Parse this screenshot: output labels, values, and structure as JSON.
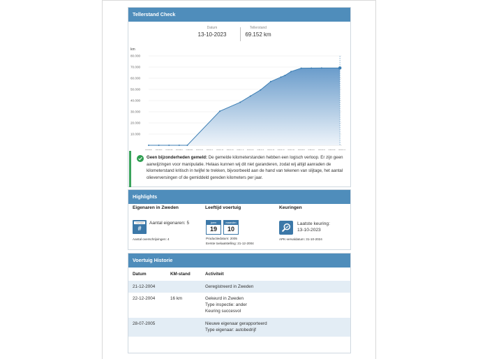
{
  "teller": {
    "title": "Tellerstand Check",
    "datum_label": "Datum",
    "datum_value": "13-10-2023",
    "stand_label": "Tellerstand",
    "stand_value": "69.152 km",
    "notice_bold": "Geen bijzonderheden gemeld:",
    "notice_text": " De gemelde kilometerstanden hebben een logisch verloop. Er zijn geen aanwijzingen voor manipulatie. Helaas kunnen wij dit niet garanderen, zodat wij altijd aanraden de kilometerstand kritisch in twijfel te trekken, bijvoorbeeld aan de hand van tekenen van slijtage, het aantal olieverversingen of de gemiddeld gereden kilometers per jaar."
  },
  "chart_data": {
    "type": "area",
    "ylabel": "km",
    "ylim": [
      0,
      80000
    ],
    "yticks": [
      10000,
      20000,
      30000,
      40000,
      50000,
      60000,
      70000,
      80000
    ],
    "ytick_labels": [
      "10.000",
      "20.000",
      "30.000",
      "40.000",
      "50.000",
      "60.000",
      "70.000",
      "80.000"
    ],
    "xlim": [
      2005,
      2024
    ],
    "xticks": [
      2005,
      2006,
      2007,
      2008,
      2009,
      2010,
      2011,
      2012,
      2013,
      2014,
      2015,
      2016,
      2017,
      2018,
      2019,
      2020,
      2021,
      2022,
      2023,
      2024
    ],
    "points": [
      {
        "x": 2005.0,
        "y": 16
      },
      {
        "x": 2006.0,
        "y": 16
      },
      {
        "x": 2007.0,
        "y": 16
      },
      {
        "x": 2008.0,
        "y": 16
      },
      {
        "x": 2008.8,
        "y": 16
      },
      {
        "x": 2012.0,
        "y": 30500
      },
      {
        "x": 2014.0,
        "y": 38500
      },
      {
        "x": 2015.0,
        "y": 44000
      },
      {
        "x": 2016.0,
        "y": 49500
      },
      {
        "x": 2017.0,
        "y": 57000
      },
      {
        "x": 2018.0,
        "y": 61000
      },
      {
        "x": 2018.4,
        "y": 62500
      },
      {
        "x": 2019.0,
        "y": 66000
      },
      {
        "x": 2020.0,
        "y": 69000
      },
      {
        "x": 2021.0,
        "y": 69100
      },
      {
        "x": 2022.0,
        "y": 69120
      },
      {
        "x": 2023.8,
        "y": 69152
      }
    ],
    "colors": {
      "line": "#3d7fb4",
      "fill_top": "#6a9ccb",
      "fill_bottom": "#eef4fa",
      "grid": "#e8e8e8"
    }
  },
  "highlights": {
    "title": "Highlights",
    "owners": {
      "title": "Eigenaren in Zweden",
      "card_label": "OWNER",
      "card_symbol": "#",
      "count_text": "Aantal eigenaren: 5",
      "transfers": "Aantal overschrijvingen: 4"
    },
    "age": {
      "title": "Leeftijd voertuig",
      "years_label": "jaren",
      "years": "19",
      "months_label": "maanden",
      "months": "10",
      "production": "Productiedatum: 2005",
      "first_admission": "Eerste toelaatstelling: 21-12-2004"
    },
    "inspection": {
      "title": "Keuringen",
      "last_label": "Laatste keuring:",
      "last_date": "13-10-2023",
      "apk": "APK-vervaldatum: 31-10-2024"
    }
  },
  "history": {
    "title": "Voertuig Historie",
    "columns": [
      "Datum",
      "KM-stand",
      "Activiteit"
    ],
    "rows": [
      {
        "date": "21-12-2004",
        "km": "",
        "lines": [
          "Geregistreerd in Zweden"
        ]
      },
      {
        "date": "22-12-2004",
        "km": "16 km",
        "lines": [
          "Gekeurd in Zweden",
          "Type inspectie: ander",
          "Keuring succesvol"
        ]
      },
      {
        "date": "28-07-2005",
        "km": "",
        "lines": [
          "Nieuwe eigenaar gerapporteerd",
          "Type eigenaar: autobedrijf"
        ]
      }
    ]
  }
}
